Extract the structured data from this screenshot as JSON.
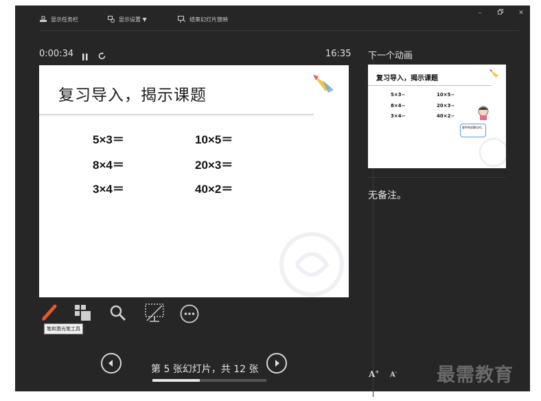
{
  "toolbar": {
    "taskbar_label": "显示任务栏",
    "display_settings_label": "显示设置 ▼",
    "end_show_label": "结束幻灯片放映"
  },
  "timer": {
    "elapsed": "0:00:34",
    "clock": "16:35"
  },
  "slide": {
    "title": "复习导入，揭示课题",
    "equations_left": [
      "5×3＝",
      "8×4＝",
      "3×4＝"
    ],
    "equations_right": [
      "10×5＝",
      "20×3＝",
      "40×2＝"
    ]
  },
  "tools": {
    "tooltip": "笔和激光笔工具"
  },
  "navigation": {
    "slide_counter": "第 5 张幻灯片，共 12 张",
    "current": 5,
    "total": 12
  },
  "next_panel": {
    "label": "下一个动画",
    "preview_title": "复习导入，揭示课题",
    "preview_left": [
      "5×3−",
      "8×4−",
      "3×4−"
    ],
    "preview_right": [
      "10×5−",
      "20×3−",
      "40×2−"
    ],
    "bubble_text": "要举例说算出吗。"
  },
  "notes": {
    "text": "无备注。",
    "increase_font": "A",
    "decrease_font": "A"
  },
  "watermark": "最需教育",
  "colors": {
    "background": "#262626",
    "accent_pen": "#e8572a"
  }
}
